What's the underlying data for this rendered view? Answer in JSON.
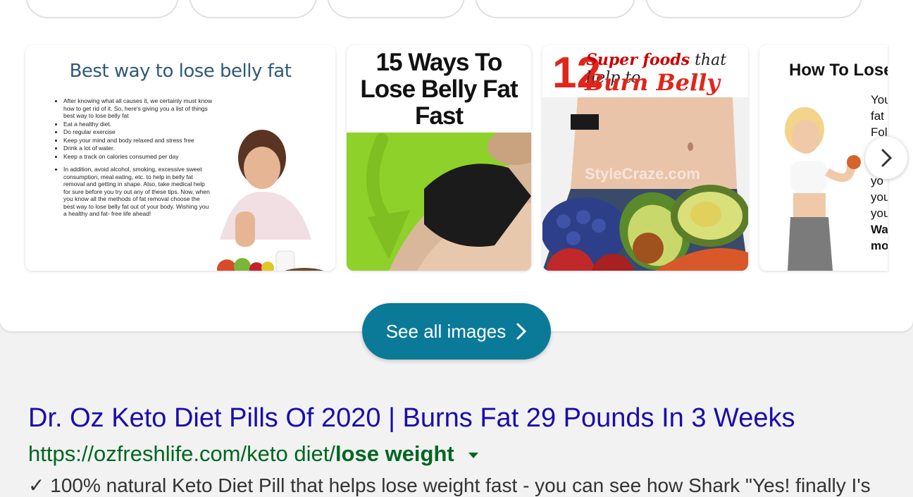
{
  "top_chips": [
    {
      "label": "chip-1"
    },
    {
      "label": "chip-2"
    },
    {
      "label": "chip-3"
    },
    {
      "label": "chip-4"
    },
    {
      "label": "chip-5"
    }
  ],
  "images": [
    {
      "title": "Best way to lose belly fat",
      "bullets": [
        "After knowing what all causes it, we certainly must know how to get rid of it. So, here's giving you a list of things best way to lose belly fat",
        "Eat a healthy diet.",
        "Do regular exercise",
        "Keep your mind and body relaxed and stress free",
        "Drink a lot of water.",
        "Keep a track on calories consumed per day",
        "In addition, avoid alcohol, smoking, excessive sweet consumption, meal eating, etc. to help in belly fat removal and getting in shape. Also, take medical help for sure before you try out any of these tips. Now, when you know all the methods of fat removal choose the best way to lose belly fat out of your body. Wishing you a healthy and fat- free life ahead!"
      ]
    },
    {
      "title": "15 Ways To Lose Belly Fat Fast"
    },
    {
      "number": "12",
      "line1_a": "Super foods",
      "line1_b": " that help to",
      "line2": "Burn Belly Fat",
      "watermark": "StyleCraze.com"
    },
    {
      "title": "How To Lose",
      "lines": [
        "You",
        "fat",
        "Foll",
        "",
        "If yo",
        "you",
        "you",
        "Wa",
        "mo"
      ]
    }
  ],
  "see_all_label": "See all images",
  "result": {
    "title": "Dr. Oz Keto Diet Pills Of 2020 | Burns Fat 29 Pounds In 3 Weeks",
    "url_plain": "https://ozfreshlife.com/keto diet/",
    "url_bold": "lose weight",
    "snippet": "✓ 100% natural Keto Diet Pill that helps lose weight fast - you can see how Shark \"Yes! finally I's"
  },
  "colors": {
    "link": "#1a0dab",
    "url": "#006621",
    "see_all_bg": "#0b7a99",
    "green_panel": "#8ed12a",
    "red_text": "#e0261c"
  },
  "icons": {
    "next": "chevron-right-icon",
    "see_all": "chevron-right-icon",
    "url_menu": "triangle-down-icon"
  }
}
